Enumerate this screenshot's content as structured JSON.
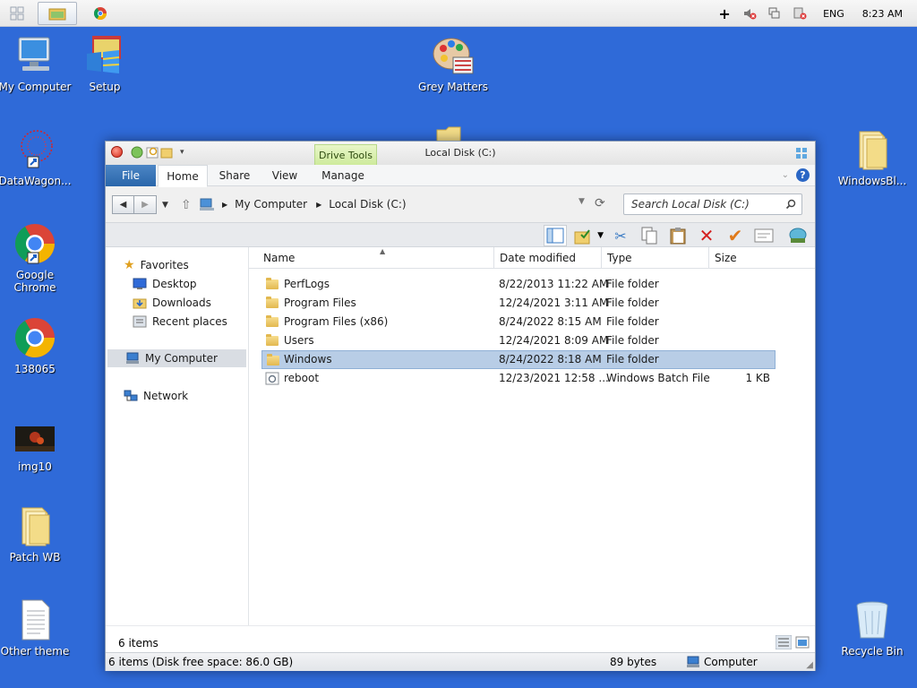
{
  "taskbar": {
    "tray_lang": "ENG",
    "tray_time": "8:23 AM"
  },
  "desktop": {
    "icons": [
      {
        "label": "My Computer"
      },
      {
        "label": "Setup"
      },
      {
        "label": "Grey Matters"
      },
      {
        "label": "DataWagon..."
      },
      {
        "label": "Google Chrome"
      },
      {
        "label": "138065"
      },
      {
        "label": "img10"
      },
      {
        "label": "Patch WB"
      },
      {
        "label": "Other theme"
      },
      {
        "label": "WindowsBl..."
      },
      {
        "label": "Recycle Bin"
      }
    ]
  },
  "window": {
    "title": "Local Disk (C:)",
    "context_tab": "Drive Tools",
    "tabs": {
      "file": "File",
      "home": "Home",
      "share": "Share",
      "view": "View",
      "manage": "Manage"
    },
    "breadcrumb": [
      "My Computer",
      "Local Disk (C:)"
    ],
    "search_placeholder": "Search Local Disk (C:)",
    "nav": {
      "favorites": "Favorites",
      "desktop": "Desktop",
      "downloads": "Downloads",
      "recent": "Recent places",
      "my_computer": "My Computer",
      "network": "Network"
    },
    "columns": {
      "name": "Name",
      "date": "Date modified",
      "type": "Type",
      "size": "Size"
    },
    "files": [
      {
        "name": "PerfLogs",
        "date": "8/22/2013 11:22 AM",
        "type": "File folder",
        "size": ""
      },
      {
        "name": "Program Files",
        "date": "12/24/2021 3:11 AM",
        "type": "File folder",
        "size": ""
      },
      {
        "name": "Program Files (x86)",
        "date": "8/24/2022 8:15 AM",
        "type": "File folder",
        "size": ""
      },
      {
        "name": "Users",
        "date": "12/24/2021 8:09 AM",
        "type": "File folder",
        "size": ""
      },
      {
        "name": "Windows",
        "date": "8/24/2022 8:18 AM",
        "type": "File folder",
        "size": ""
      },
      {
        "name": "reboot",
        "date": "12/23/2021 12:58 ...",
        "type": "Windows Batch File",
        "size": "1 KB"
      }
    ],
    "item_count": "6 items",
    "status": "6 items (Disk free space: 86.0 GB)",
    "status_size": "89 bytes",
    "status_location": "Computer"
  }
}
